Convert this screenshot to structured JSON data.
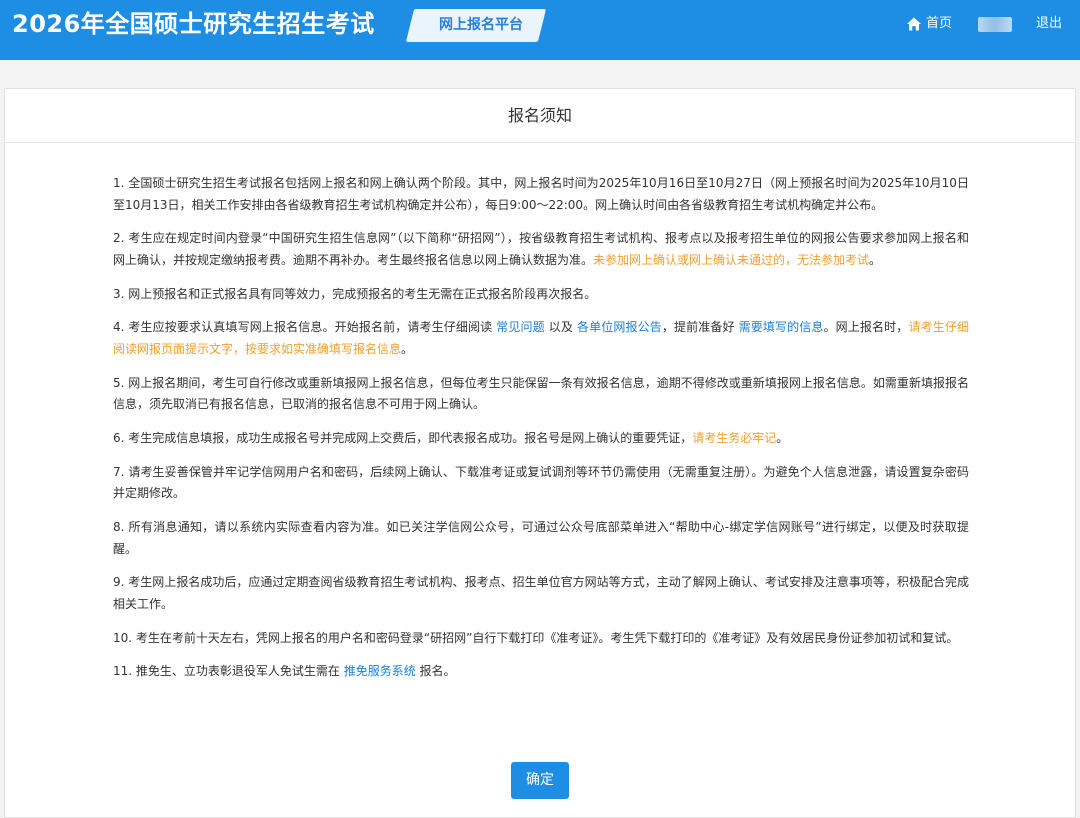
{
  "header": {
    "site_title": "2026年全国硕士研究生招生考试",
    "platform_tag": "网上报名平台",
    "home_label": "首页",
    "logout_label": "退出",
    "home_icon": "home-icon",
    "bar_color": "#1d8ee3"
  },
  "panel": {
    "title": "报名须知",
    "confirm_label": "确定"
  },
  "colors": {
    "link": "#1d7fd8",
    "warning": "#f0a030",
    "text": "#333333"
  },
  "notices": [
    [
      {
        "t": "1. 全国硕士研究生招生考试报名包括网上报名和网上确认两个阶段。其中，网上报名时间为2025年10月16日至10月27日（网上预报名时间为2025年10月10日至10月13日，相关工作安排由各省级教育招生考试机构确定并公布），每日9:00～22:00。网上确认时间由各省级教育招生考试机构确定并公布。"
      }
    ],
    [
      {
        "t": "2. 考生应在规定时间内登录“中国研究生招生信息网”（以下简称“研招网”），按省级教育招生考试机构、报考点以及报考招生单位的网报公告要求参加网上报名和网上确认，并按规定缴纳报考费。逾期不再补办。考生最终报名信息以网上确认数据为准。"
      },
      {
        "t": "未参加网上确认或网上确认未通过的，无法参加考试",
        "style": "warn"
      },
      {
        "t": "。"
      }
    ],
    [
      {
        "t": "3. 网上预报名和正式报名具有同等效力，完成预报名的考生无需在正式报名阶段再次报名。"
      }
    ],
    [
      {
        "t": "4. 考生应按要求认真填写网上报名信息。开始报名前，请考生仔细阅读 "
      },
      {
        "t": "常见问题",
        "style": "link",
        "name": "faq-link"
      },
      {
        "t": " 以及 "
      },
      {
        "t": "各单位网报公告",
        "style": "link",
        "name": "unit-announcement-link"
      },
      {
        "t": "，提前准备好 "
      },
      {
        "t": "需要填写的信息",
        "style": "link",
        "name": "required-info-link"
      },
      {
        "t": "。网上报名时，"
      },
      {
        "t": "请考生仔细阅读网报页面提示文字，按要求如实准确填写报名信息",
        "style": "warn"
      },
      {
        "t": "。"
      }
    ],
    [
      {
        "t": "5. 网上报名期间，考生可自行修改或重新填报网上报名信息，但每位考生只能保留一条有效报名信息，逾期不得修改或重新填报网上报名信息。如需重新填报报名信息，须先取消已有报名信息，已取消的报名信息不可用于网上确认。"
      }
    ],
    [
      {
        "t": "6. 考生完成信息填报，成功生成报名号并完成网上交费后，即代表报名成功。报名号是网上确认的重要凭证，"
      },
      {
        "t": "请考生务必牢记",
        "style": "warn"
      },
      {
        "t": "。"
      }
    ],
    [
      {
        "t": "7. 请考生妥善保管并牢记学信网用户名和密码，后续网上确认、下载准考证或复试调剂等环节仍需使用（无需重复注册）。为避免个人信息泄露，请设置复杂密码并定期修改。"
      }
    ],
    [
      {
        "t": "8. 所有消息通知，请以系统内实际查看内容为准。如已关注学信网公众号，可通过公众号底部菜单进入“帮助中心-绑定学信网账号”进行绑定，以便及时获取提醒。"
      }
    ],
    [
      {
        "t": "9. 考生网上报名成功后，应通过定期查阅省级教育招生考试机构、报考点、招生单位官方网站等方式，主动了解网上确认、考试安排及注意事项等，积极配合完成相关工作。"
      }
    ],
    [
      {
        "t": "10. 考生在考前十天左右，凭网上报名的用户名和密码登录“研招网”自行下载打印《准考证》。考生凭下载打印的《准考证》及有效居民身份证参加初试和复试。"
      }
    ],
    [
      {
        "t": "11. 推免生、立功表彰退役军人免试生需在 "
      },
      {
        "t": "推免服务系统",
        "style": "link",
        "name": "recommend-system-link"
      },
      {
        "t": " 报名。"
      }
    ]
  ]
}
